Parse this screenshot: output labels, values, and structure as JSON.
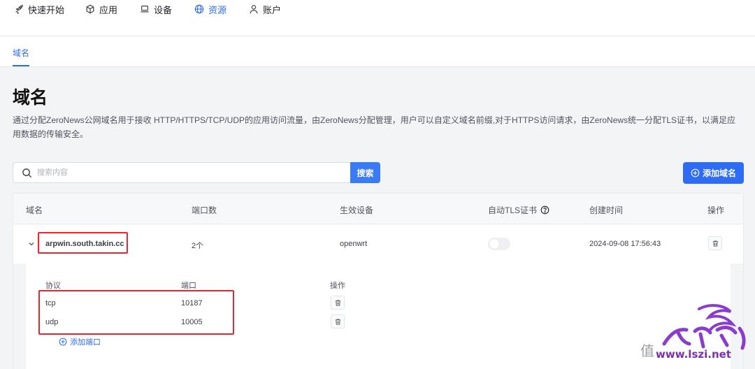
{
  "nav": {
    "items": [
      {
        "label": "快速开始",
        "icon": "rocket-icon"
      },
      {
        "label": "应用",
        "icon": "cube-icon"
      },
      {
        "label": "设备",
        "icon": "laptop-icon"
      },
      {
        "label": "资源",
        "icon": "globe-icon"
      },
      {
        "label": "账户",
        "icon": "user-icon"
      }
    ],
    "active": "资源"
  },
  "tabs": {
    "active_label": "域名"
  },
  "page": {
    "title": "域名",
    "description": "通过分配ZeroNews公网域名用于接收 HTTP/HTTPS/TCP/UDP的应用访问流量，由ZeroNews分配管理，用户可以自定义域名前缀,对于HTTPS访问请求，由ZeroNews统一分配TLS证书，以满足应用数据的传输安全。"
  },
  "search": {
    "placeholder": "搜索内容",
    "button_label": "搜索"
  },
  "add_domain_label": "添加域名",
  "table": {
    "headers": {
      "domain": "域名",
      "ports": "端口数",
      "device": "生效设备",
      "tls": "自动TLS证书",
      "created": "创建时间",
      "actions": "操作"
    },
    "rows": [
      {
        "domain": "arpwin.south.takin.cc",
        "ports": "2个",
        "device": "openwrt",
        "tls_enabled": false,
        "created": "2024-09-08 17:56:43",
        "expanded": true,
        "sub": {
          "headers": {
            "protocol": "协议",
            "port": "端口",
            "actions": "操作"
          },
          "rows": [
            {
              "protocol": "tcp",
              "port": "10187"
            },
            {
              "protocol": "udp",
              "port": "10005"
            }
          ],
          "add_port_label": "添加端口"
        }
      }
    ]
  },
  "colors": {
    "accent": "#2e6cf6",
    "highlight": "#e8262d"
  },
  "watermark": {
    "char": "值",
    "site": "www.lszi.net"
  }
}
